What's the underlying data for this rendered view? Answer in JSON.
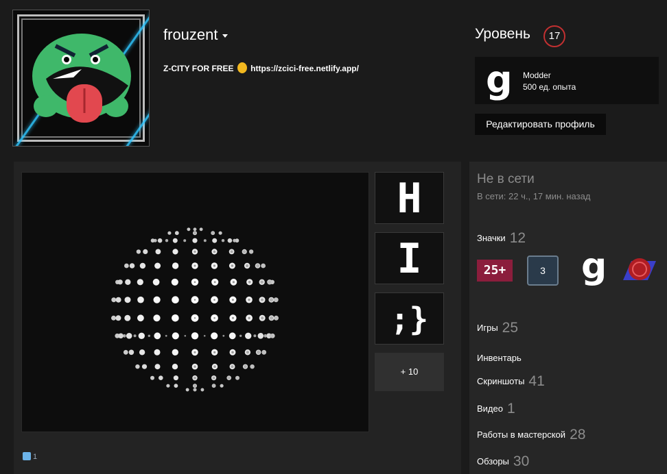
{
  "profile": {
    "username": "frouzent",
    "summary_text": "Z-CITY FOR FREE",
    "summary_link": "https://zcici-free.netlify.app/"
  },
  "level": {
    "label": "Уровень",
    "value": "17"
  },
  "featured_badge": {
    "icon_letter": "g",
    "name": "Modder",
    "xp": "500 ед. опыта"
  },
  "edit_profile_label": "Редактировать профиль",
  "showcase": {
    "tiles": [
      "H",
      "I",
      ";}"
    ],
    "more_label": "+ 10",
    "likes": "1"
  },
  "status": {
    "title": "Не в сети",
    "last_seen": "В сети: 22 ч., 17 мин. назад"
  },
  "badges": {
    "label": "Значки",
    "count": "12",
    "items": [
      {
        "icon": "badge-25-years-icon",
        "text": "25+"
      },
      {
        "icon": "badge-level-3-icon",
        "text": "3"
      },
      {
        "icon": "badge-gmod-icon",
        "text": "g"
      },
      {
        "icon": "badge-seal-icon"
      }
    ]
  },
  "stats": [
    {
      "label": "Игры",
      "count": "25"
    },
    {
      "label": "Инвентарь",
      "count": ""
    },
    {
      "label": "Скриншоты",
      "count": "41"
    },
    {
      "label": "Видео",
      "count": "1"
    },
    {
      "label": "Работы в мастерской",
      "count": "28"
    },
    {
      "label": "Обзоры",
      "count": "30"
    }
  ],
  "colors": {
    "background": "#1b1b1b",
    "level_ring": "#c23031",
    "avatar_neon": "#2fc6ff",
    "avatar_face": "#3fb86a",
    "tongue": "#e2484f"
  }
}
